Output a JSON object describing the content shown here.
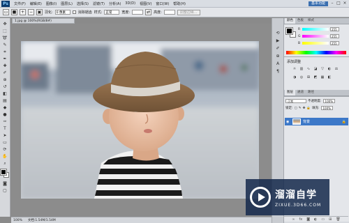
{
  "app": {
    "logo": "Ps"
  },
  "menu": [
    "文件(F)",
    "编辑(E)",
    "图像(I)",
    "图层(L)",
    "选择(S)",
    "滤镜(T)",
    "分析(A)",
    "3D(D)",
    "视图(V)",
    "窗口(W)",
    "帮助(H)"
  ],
  "workspace_label": "基本功能",
  "options": {
    "feather_label": "羽化:",
    "feather_value": "0 像素",
    "antialias_label": "消除锯齿",
    "style_label": "样式:",
    "style_value": "正常",
    "width_label": "宽度:",
    "height_label": "高度:",
    "refine_edge_label": "调整边缘..."
  },
  "document": {
    "tab_title": "1.jpg @ 100%(RGB/8#)"
  },
  "status": {
    "zoom": "100%",
    "doc_info": "文档:1.54M/1.54M"
  },
  "panels": {
    "color_tabs": [
      "颜色",
      "色板",
      "样式"
    ],
    "color_values": {
      "r": "255",
      "g": "255",
      "b": "255"
    },
    "adjust_title": "添加调整",
    "layers_tabs": [
      "图层",
      "通道",
      "路径"
    ],
    "blend_mode": "正常",
    "opacity_label": "不透明度:",
    "opacity_value": "100%",
    "lock_label": "锁定:",
    "fill_label": "填充:",
    "fill_value": "100%",
    "layer_name": "背景"
  },
  "watermark": {
    "name": "溜溜自学",
    "url": "ZIXUE.3D66.COM"
  },
  "colors": {
    "accent": "#3c78c8",
    "menubar": "#d9dde3",
    "canvas": "#8c8c8c"
  }
}
